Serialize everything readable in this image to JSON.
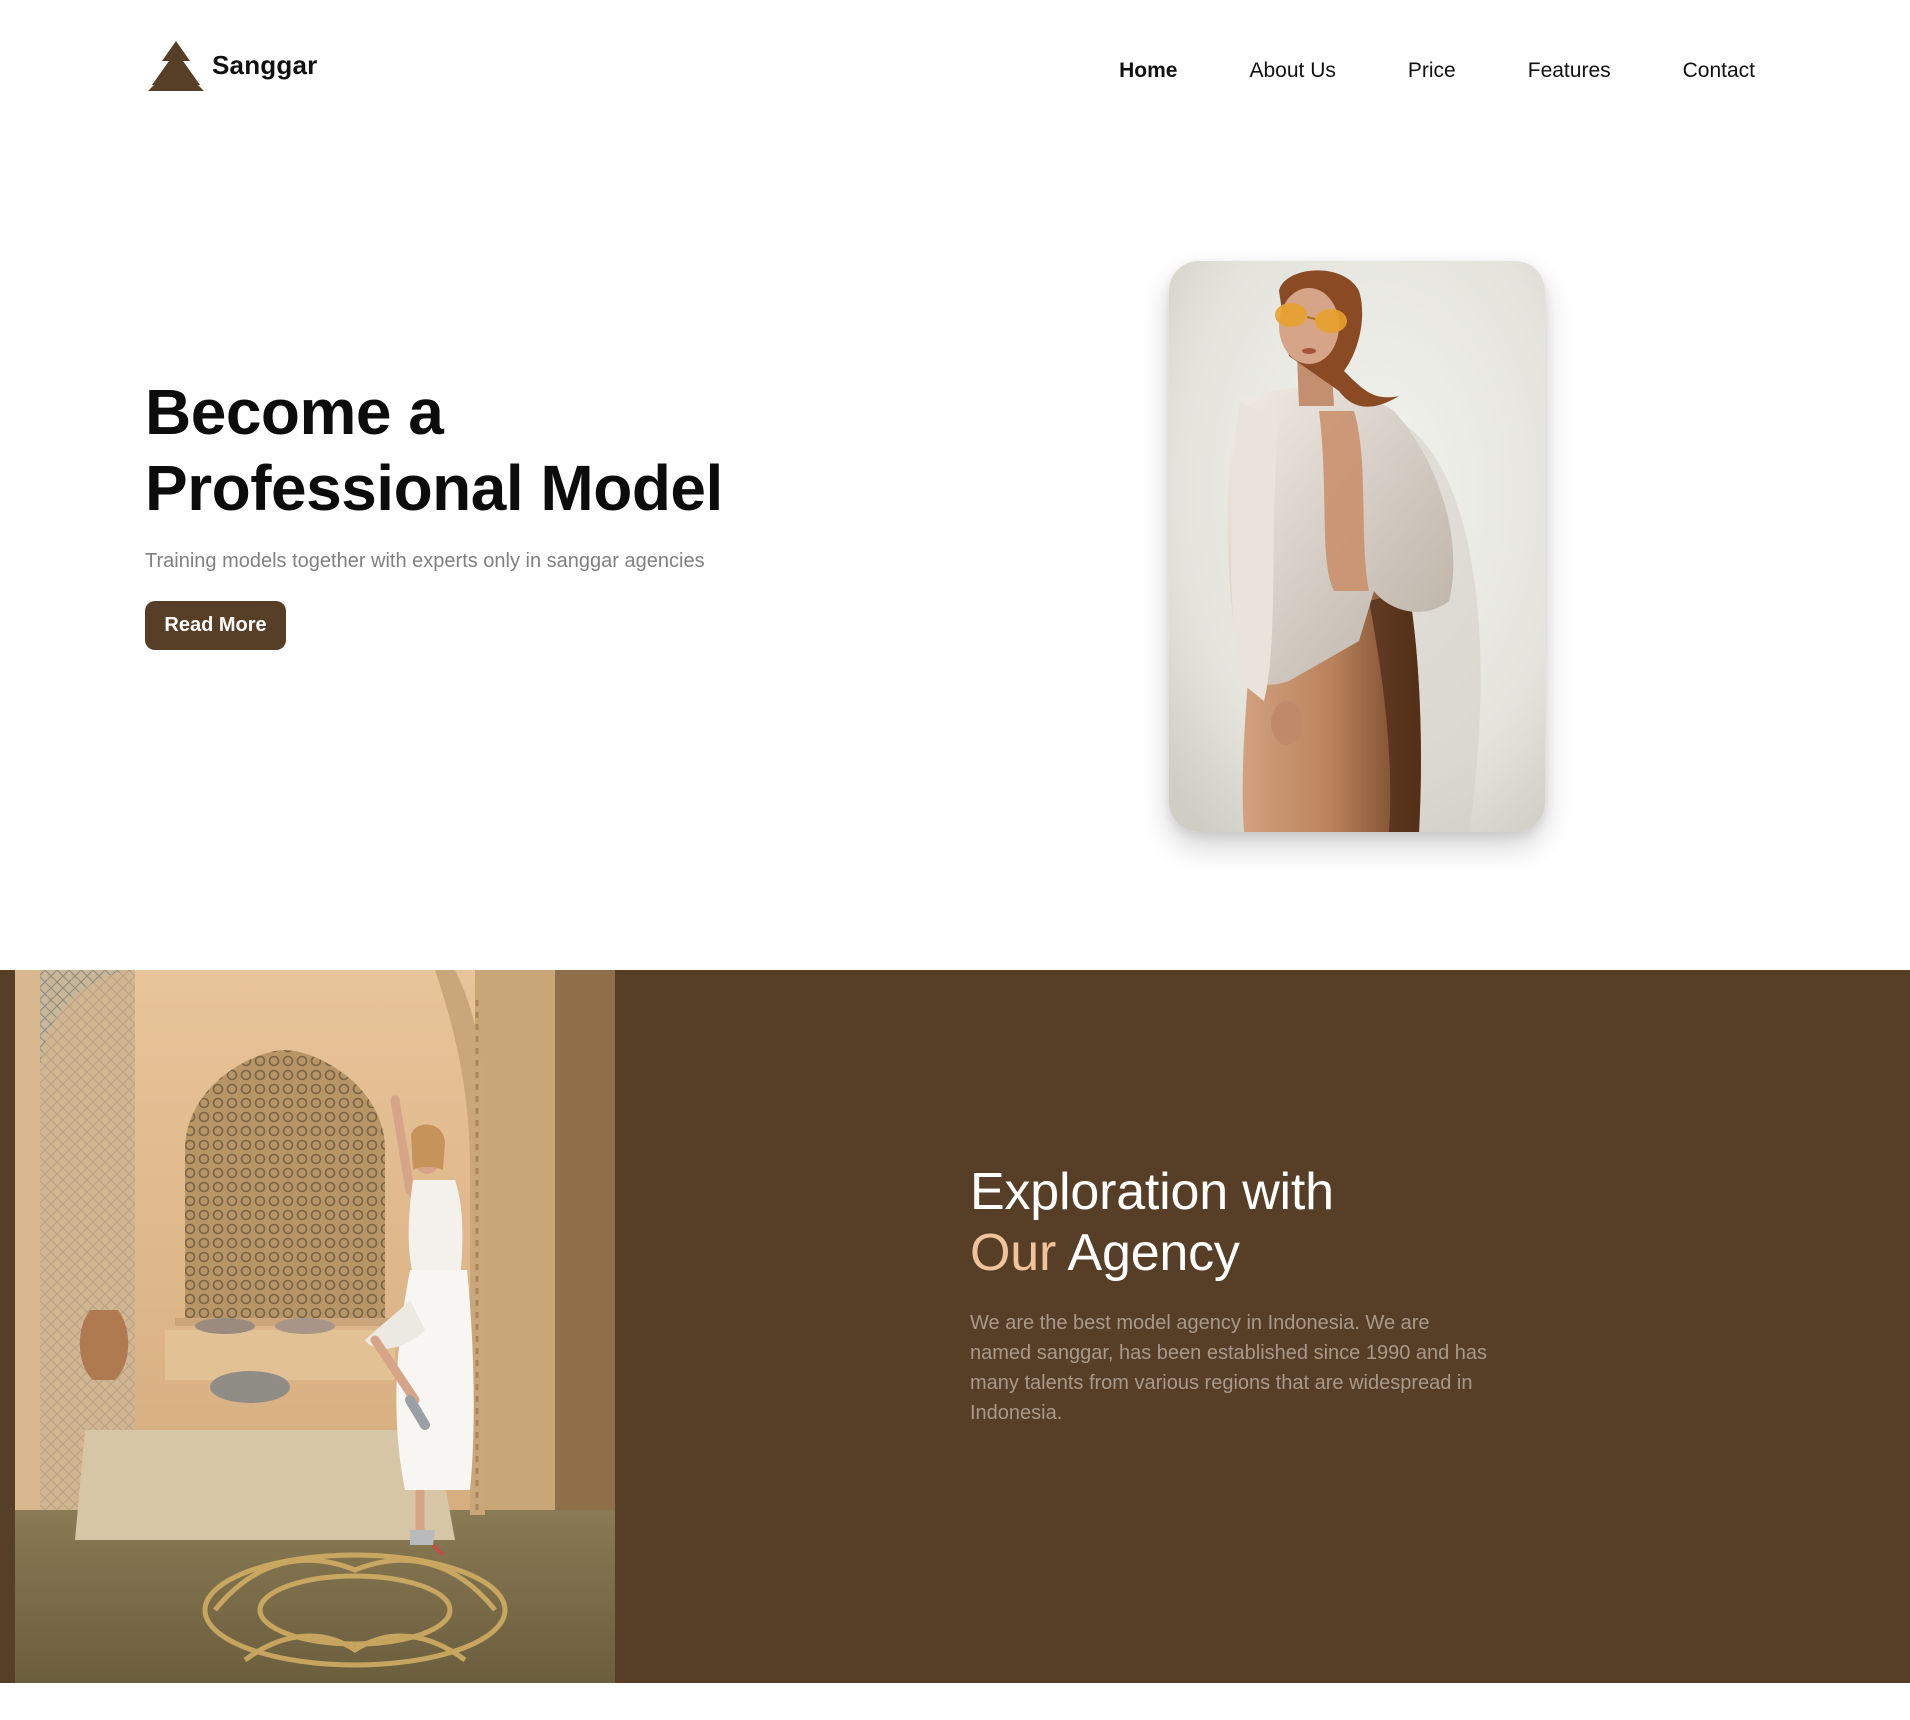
{
  "header": {
    "logo_text": "Sanggar",
    "logo_icon": "tree-icon",
    "nav": [
      {
        "label": "Home",
        "active": true
      },
      {
        "label": "About Us",
        "active": false
      },
      {
        "label": "Price",
        "active": false
      },
      {
        "label": "Features",
        "active": false
      },
      {
        "label": "Contact",
        "active": false
      }
    ]
  },
  "hero": {
    "title_line1": "Become a",
    "title_line2": "Professional Model",
    "subtitle": "Training models together with experts only in sanggar agencies",
    "button_label": "Read More"
  },
  "exploration": {
    "title_line1": "Exploration with",
    "title_accent": "Our",
    "title_rest": "Agency",
    "description": "We are the best model agency in Indonesia. We are named sanggar, has been established since 1990 and has many talents from various regions that are widespread in Indonesia."
  },
  "colors": {
    "brand": "#573f27",
    "accent": "#f0c39a",
    "muted_text": "#808080",
    "section_text": "#a8998a"
  }
}
